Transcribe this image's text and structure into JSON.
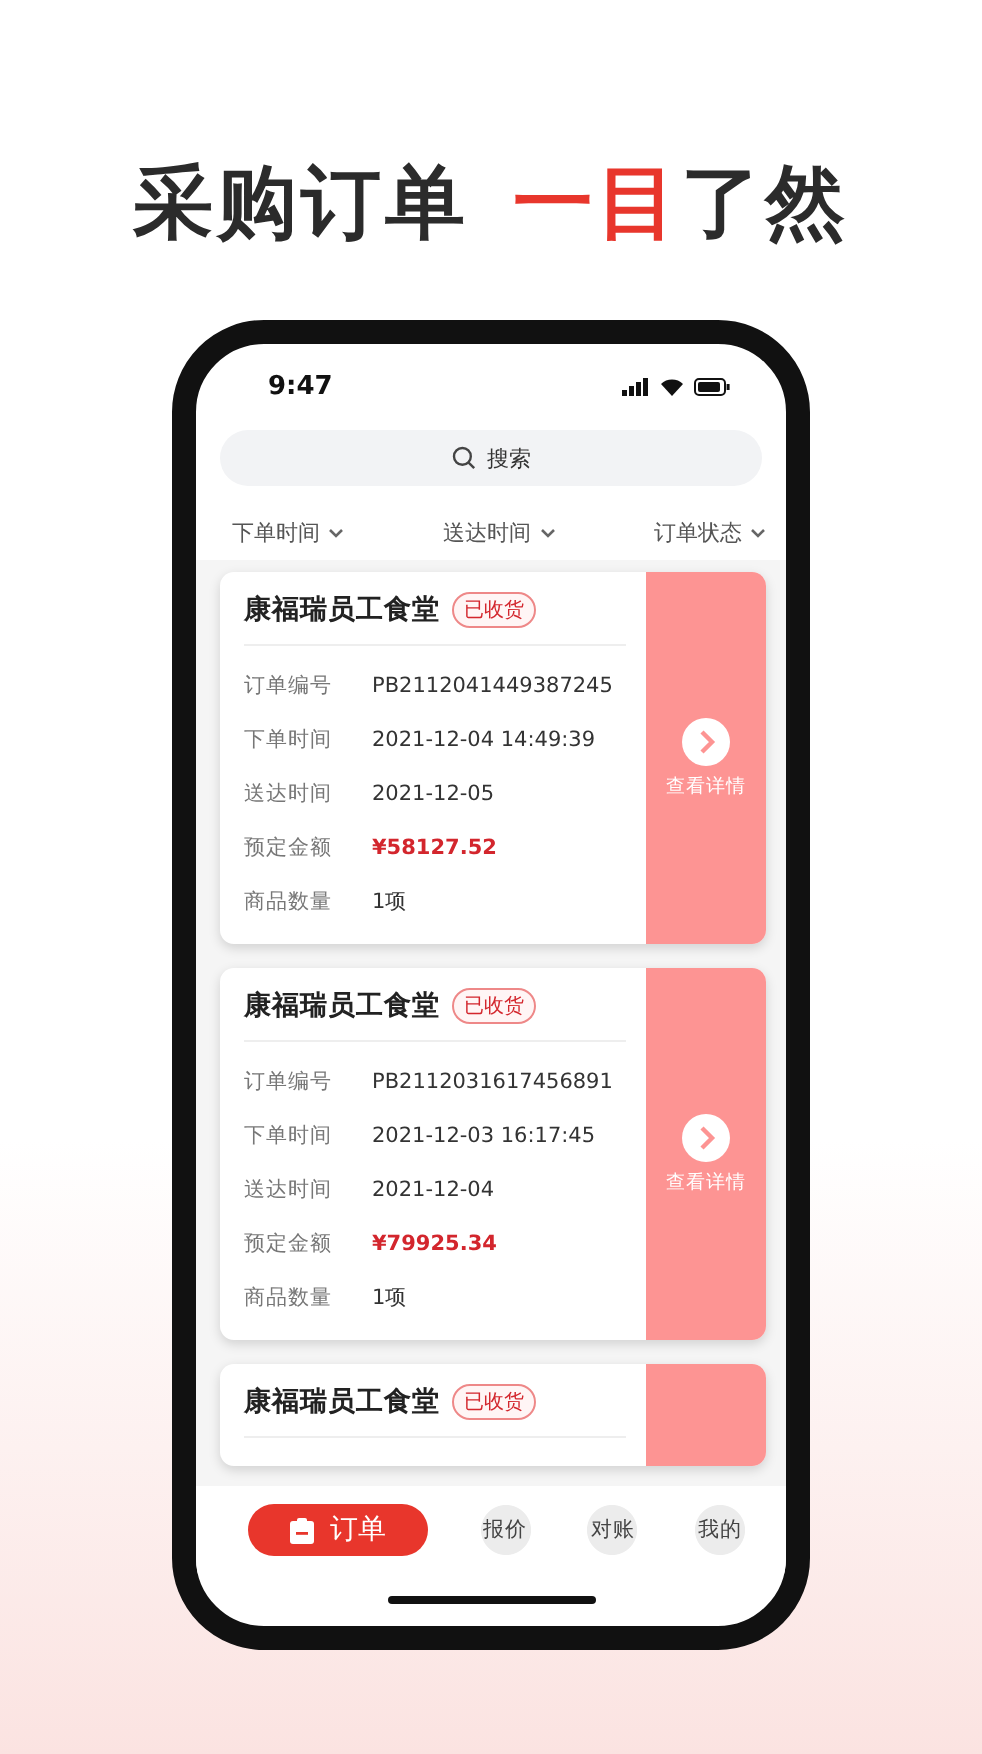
{
  "headline": [
    {
      "text": "采购订单",
      "highlight": false
    },
    {
      "text": "一目",
      "highlight": true
    },
    {
      "text": "了然",
      "highlight": false
    }
  ],
  "status_bar": {
    "time": "9:47"
  },
  "search": {
    "placeholder": "搜索"
  },
  "filters": [
    {
      "label": "下单时间"
    },
    {
      "label": "送达时间"
    },
    {
      "label": "订单状态"
    }
  ],
  "orders": [
    {
      "name": "康福瑞员工食堂",
      "status": "已收货",
      "detail": "查看详情",
      "rows": [
        {
          "label": "订单编号",
          "value": "PB2112041449387245",
          "kind": "text"
        },
        {
          "label": "下单时间",
          "value": "2021-12-04 14:49:39",
          "kind": "text"
        },
        {
          "label": "送达时间",
          "value": "2021-12-05",
          "kind": "text"
        },
        {
          "label": "预定金额",
          "value": "¥58127.52",
          "kind": "amount"
        },
        {
          "label": "商品数量",
          "value": "1项",
          "kind": "text"
        }
      ]
    },
    {
      "name": "康福瑞员工食堂",
      "status": "已收货",
      "detail": "查看详情",
      "rows": [
        {
          "label": "订单编号",
          "value": "PB2112031617456891",
          "kind": "text"
        },
        {
          "label": "下单时间",
          "value": "2021-12-03 16:17:45",
          "kind": "text"
        },
        {
          "label": "送达时间",
          "value": "2021-12-04",
          "kind": "text"
        },
        {
          "label": "预定金额",
          "value": "¥79925.34",
          "kind": "amount"
        },
        {
          "label": "商品数量",
          "value": "1项",
          "kind": "text"
        }
      ]
    },
    {
      "name": "康福瑞员工食堂",
      "status": "已收货"
    }
  ],
  "tabs": [
    {
      "label": "订单",
      "selected": true
    },
    {
      "label": "报价",
      "selected": false
    },
    {
      "label": "对账",
      "selected": false
    },
    {
      "label": "我的",
      "selected": false
    }
  ]
}
